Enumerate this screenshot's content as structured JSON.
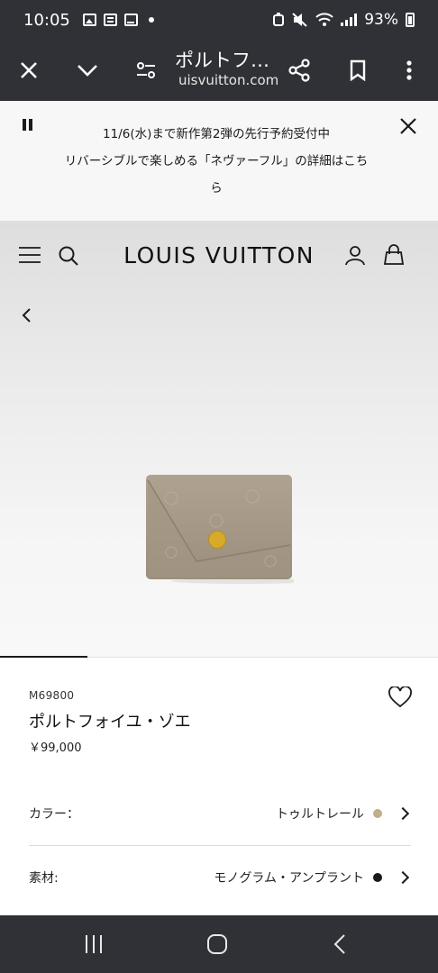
{
  "status_bar": {
    "time": "10:05",
    "battery": "93%",
    "notification_icons": [
      "gallery-icon",
      "news-icon",
      "mail-icon",
      "dot-icon"
    ],
    "system_icons": [
      "alarm-icon",
      "mute-icon",
      "wifi-icon",
      "signal-icon",
      "battery-icon"
    ]
  },
  "browser_toolbar": {
    "title": "ポルトフ…",
    "url": "uisvuitton.com"
  },
  "announcement": {
    "line1": "11/6(水)まで新作第2弾の先行予約受付中",
    "line2": "リバーシブルで楽しめる「ネヴァーフル」の詳細はこち",
    "line3": "ら"
  },
  "header": {
    "brand": "LOUIS VUITTON"
  },
  "gallery": {
    "current_index": 1,
    "total_segments": 5,
    "colors": {
      "wallet": "#a89a88",
      "clasp": "#d8aa2a"
    }
  },
  "product": {
    "sku": "M69800",
    "name": "ポルトフォイユ・ゾエ",
    "price": "￥99,000"
  },
  "options": {
    "color_label": "カラー：",
    "color_value": "トゥルトレール",
    "color_swatch": "#c2ad8c",
    "material_label": "素材:",
    "material_value": "モノグラム・アンプラント",
    "material_swatch": "#1a1a1a"
  },
  "theme": {
    "system_bar": "#303136",
    "banner_bg": "#f7f7f7"
  }
}
